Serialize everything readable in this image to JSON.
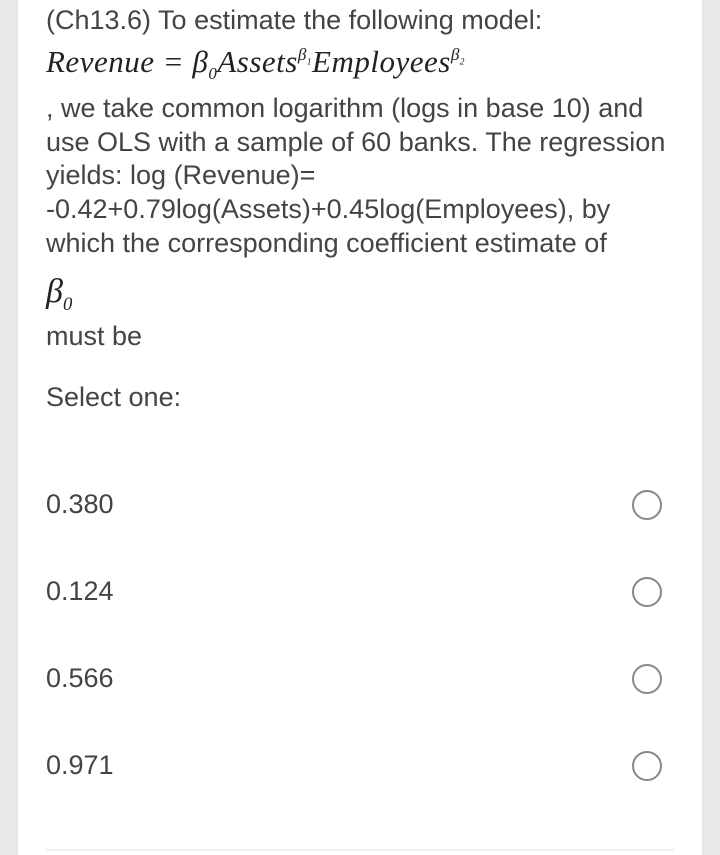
{
  "question": {
    "intro": "(Ch13.6) To estimate the following model:",
    "equation_html": "Revenue = β<span class=\"sub\">0</span>Assets<span class=\"sup\">β<span class=\"sub\">1</span></span>Employees<span class=\"sup\">β<span class=\"sub\">2</span></span>",
    "body": ", we take common logarithm (logs in base 10) and use OLS with a sample of 60 banks. The regression yields: log (Revenue)= -0.42+0.79log(Assets)+0.45log(Employees), by which the corresponding coefficient estimate of",
    "beta0_html": "β<span class=\"sub\">0</span>",
    "must_be": "must be",
    "select_one": "Select one:"
  },
  "options": [
    {
      "label": "0.380"
    },
    {
      "label": "0.124"
    },
    {
      "label": "0.566"
    },
    {
      "label": "0.971"
    }
  ]
}
